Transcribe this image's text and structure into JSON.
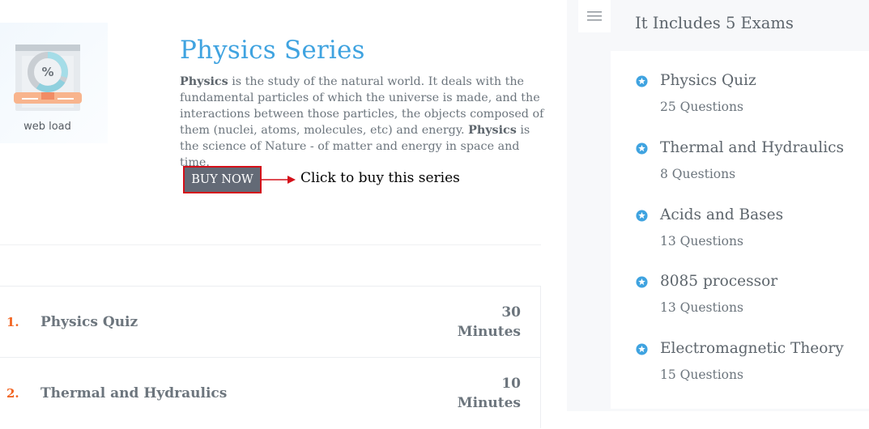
{
  "product": {
    "image_caption": "web load",
    "title": "Physics Series",
    "description_parts": [
      {
        "text": "Physics",
        "bold": true
      },
      {
        "text": " is the study of the natural world. It deals with the fundamental particles of which the universe is made, and the interactions between those particles, the objects composed of them (nuclei, atoms, molecules, etc) and energy. ",
        "bold": false
      },
      {
        "text": "Physics",
        "bold": true
      },
      {
        "text": " is the science of Nature - of matter and energy in space and time.",
        "bold": false
      }
    ],
    "buy_label": "BUY NOW",
    "buy_hint": "Click to buy this series"
  },
  "exam_table": {
    "rows": [
      {
        "number": "1.",
        "name": "Physics Quiz",
        "duration_value": "30",
        "duration_unit": "Minutes"
      },
      {
        "number": "2.",
        "name": "Thermal and Hydraulics",
        "duration_value": "10",
        "duration_unit": "Minutes"
      }
    ]
  },
  "sidebar": {
    "menu_icon": "hamburger-icon",
    "title": "It Includes 5 Exams",
    "exams": [
      {
        "name": "Physics Quiz",
        "questions": "25 Questions"
      },
      {
        "name": "Thermal and Hydraulics",
        "questions": "8 Questions"
      },
      {
        "name": "Acids and Bases",
        "questions": "13 Questions"
      },
      {
        "name": "8085 processor",
        "questions": "13 Questions"
      },
      {
        "name": "Electromagnetic Theory",
        "questions": "15 Questions"
      }
    ]
  },
  "colors": {
    "title_blue": "#3fa3e0",
    "row_number_orange": "#f26522",
    "buy_button_bg": "#636a76",
    "buy_button_border": "#d4101a",
    "arrow_red": "#d4101a",
    "star_blue": "#3fa3e0"
  }
}
